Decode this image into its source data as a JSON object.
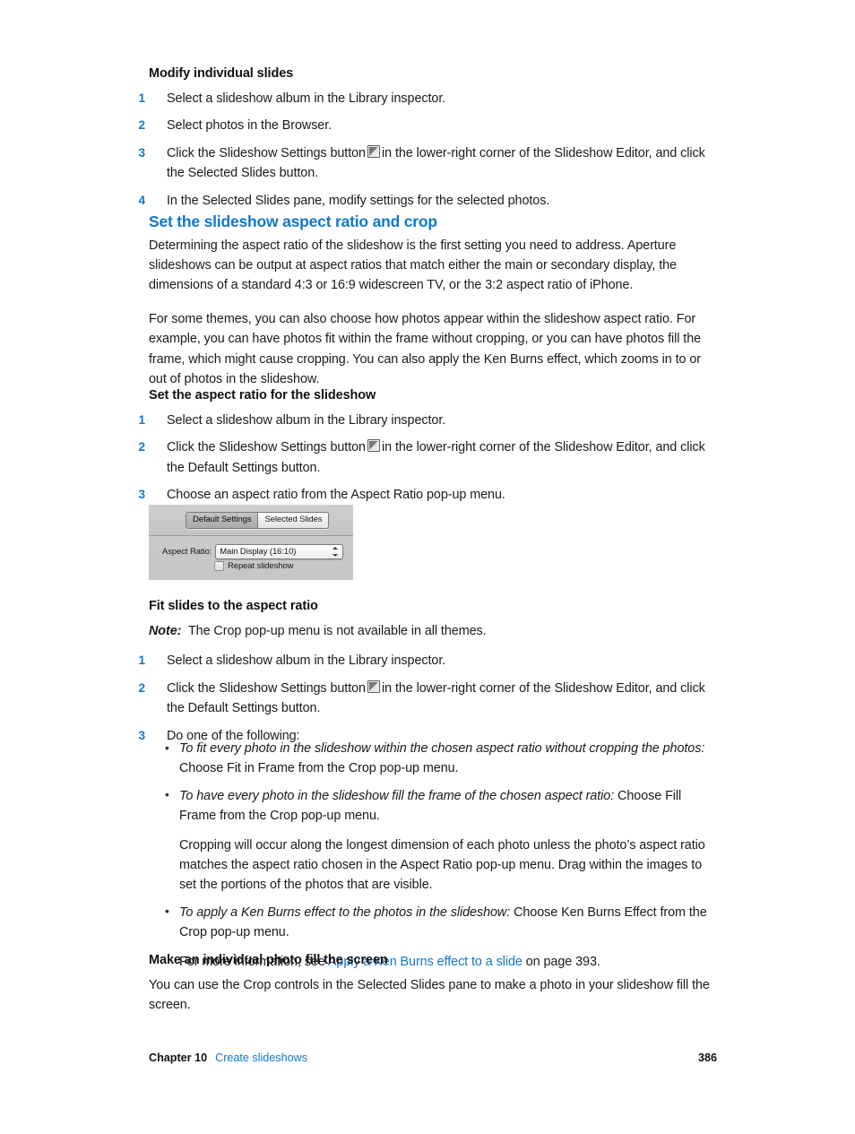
{
  "colors": {
    "link": "#1277cd",
    "heading": "#1277cd",
    "body": "#1b1b1b",
    "figure_bg": "#c9c9c9"
  },
  "sections": {
    "modify_individual_slides": {
      "heading": "Modify individual slides",
      "steps": [
        {
          "num": "1",
          "before": "Select a slideshow album in the Library inspector.",
          "icon": false,
          "after": ""
        },
        {
          "num": "2",
          "before": "Select photos in the Browser.",
          "icon": false,
          "after": ""
        },
        {
          "num": "3",
          "before": "Click the Slideshow Settings button",
          "icon": true,
          "after": "in the lower-right corner of the Slideshow Editor, and click the Selected Slides button."
        },
        {
          "num": "4",
          "before": "In the Selected Slides pane, modify settings for the selected photos.",
          "icon": false,
          "after": ""
        }
      ]
    },
    "aspect_ratio_and_crop": {
      "heading": "Set the slideshow aspect ratio and crop",
      "paragraph_1": "Determining the aspect ratio of the slideshow is the first setting you need to address. Aperture slideshows can be output at aspect ratios that match either the main or secondary display, the dimensions of a standard 4:3 or 16:9 widescreen TV, or the 3:2 aspect ratio of iPhone.",
      "paragraph_2": "For some themes, you can also choose how photos appear within the slideshow aspect ratio. For example, you can have photos fit within the frame without cropping, or you can have photos fill the frame, which might cause cropping. You can also apply the Ken Burns effect, which zooms in to or out of photos in the slideshow."
    },
    "set_aspect_ratio": {
      "heading": "Set the aspect ratio for the slideshow",
      "steps": [
        {
          "num": "1",
          "before": "Select a slideshow album in the Library inspector.",
          "icon": false,
          "after": ""
        },
        {
          "num": "2",
          "before": "Click the Slideshow Settings button",
          "icon": true,
          "after": "in the lower-right corner of the Slideshow Editor, and click the Default Settings button."
        },
        {
          "num": "3",
          "before": "Choose an aspect ratio from the Aspect Ratio pop-up menu.",
          "icon": false,
          "after": ""
        }
      ]
    },
    "fit_slides": {
      "heading": "Fit slides to the aspect ratio",
      "note_label": "Note:",
      "note_text": "The Crop pop-up menu is not available in all themes.",
      "steps": [
        {
          "num": "1",
          "before": "Select a slideshow album in the Library inspector.",
          "icon": false,
          "after": ""
        },
        {
          "num": "2",
          "before": "Click the Slideshow Settings button",
          "icon": true,
          "after": "in the lower-right corner of the Slideshow Editor, and click the Default Settings button."
        },
        {
          "num": "3",
          "before": "Do one of the following:",
          "icon": false,
          "after": ""
        }
      ],
      "bullets": [
        {
          "italic": "To fit every photo in the slideshow within the chosen aspect ratio without cropping the photos:",
          "plain": " Choose Fit in Frame from the Crop pop-up menu.",
          "nested": ""
        },
        {
          "italic": "To have every photo in the slideshow fill the frame of the chosen aspect ratio:",
          "plain": " Choose Fill Frame from the Crop pop-up menu.",
          "nested": "Cropping will occur along the longest dimension of each photo unless the photo’s aspect ratio matches the aspect ratio chosen in the Aspect Ratio pop-up menu. Drag within the images to set the portions of the photos that are visible."
        },
        {
          "italic": "To apply a Ken Burns effect to the photos in the slideshow:",
          "plain": " Choose Ken Burns Effect from the Crop pop-up menu.",
          "nested": ""
        }
      ],
      "more_info_prefix": "For more information, see ",
      "more_info_link": "Apply a Ken Burns effect to a slide",
      "more_info_suffix": " on page 393."
    },
    "fill_screen": {
      "heading": "Make an individual photo fill the screen",
      "paragraph": "You can use the Crop controls in the Selected Slides pane to make a photo in your slideshow fill the screen."
    }
  },
  "figure": {
    "segmented": {
      "default_settings": "Default Settings",
      "selected_slides": "Selected Slides"
    },
    "aspect_ratio_label": "Aspect Ratio:",
    "aspect_ratio_value": "Main Display (16:10)",
    "repeat_checkbox_label": "Repeat slideshow"
  },
  "footer": {
    "chapter": "Chapter 10",
    "chapter_title": "Create slideshows",
    "page_number": "386"
  }
}
